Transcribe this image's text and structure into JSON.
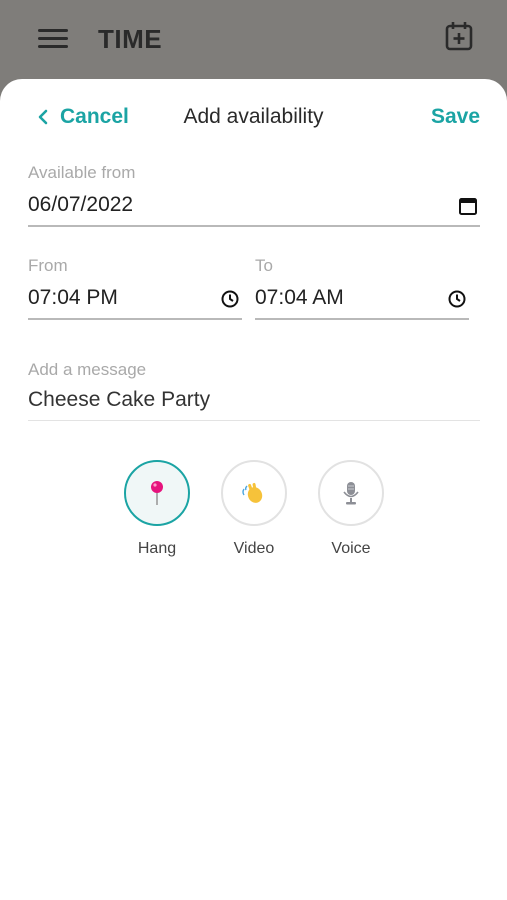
{
  "app": {
    "title": "TIME"
  },
  "sheet": {
    "title": "Add availability",
    "cancel_label": "Cancel",
    "save_label": "Save"
  },
  "form": {
    "available_from": {
      "label": "Available from",
      "value": "06/07/2022"
    },
    "from": {
      "label": "From",
      "value": "07:04  PM"
    },
    "to": {
      "label": "To",
      "value": "07:04  AM"
    },
    "message": {
      "label": "Add a message",
      "value": "Cheese Cake Party"
    }
  },
  "options": [
    {
      "label": "Hang",
      "icon": "pin-icon",
      "selected": true
    },
    {
      "label": "Video",
      "icon": "wave-hand-icon",
      "selected": false
    },
    {
      "label": "Voice",
      "icon": "microphone-icon",
      "selected": false
    }
  ],
  "colors": {
    "accent": "#1ba4a4",
    "overlay": "#7f7d7a"
  }
}
